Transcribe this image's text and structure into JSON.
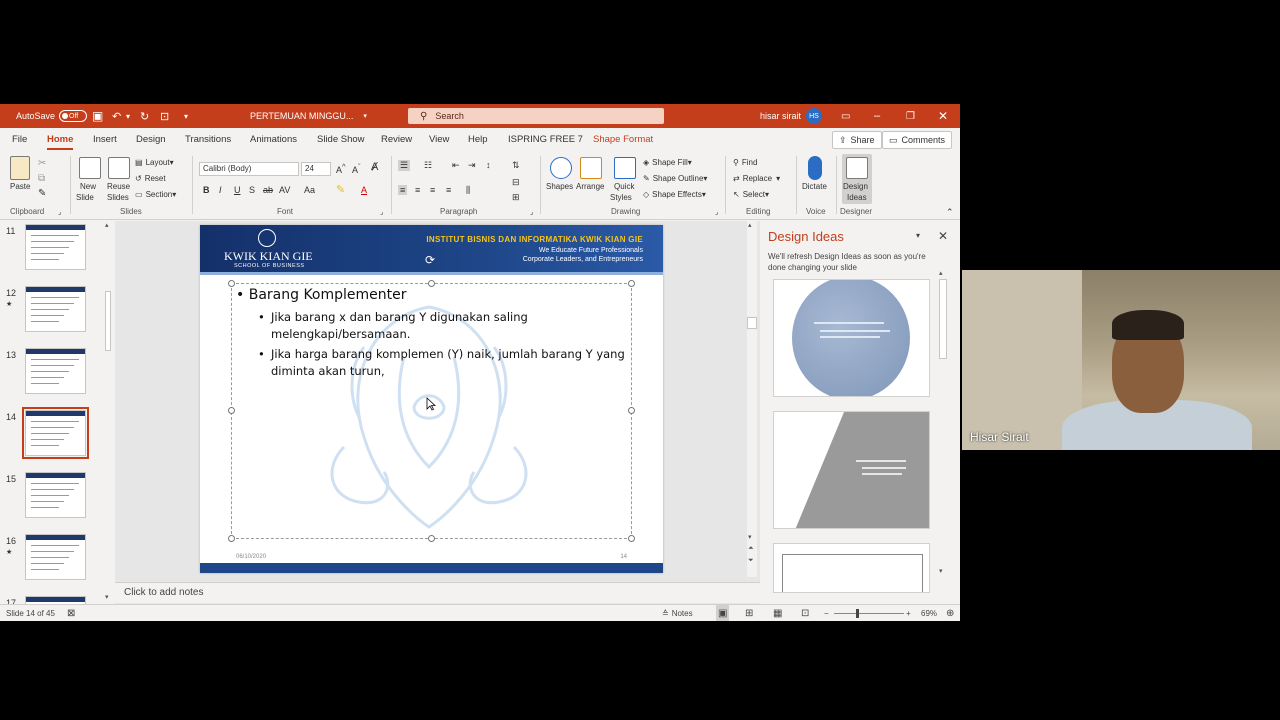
{
  "titlebar": {
    "autosave_label": "AutoSave",
    "autosave_state": "Off",
    "document_title": "PERTEMUAN MINGGU...",
    "search_placeholder": "Search",
    "user_name": "hisar sirait",
    "user_initials": "HS"
  },
  "tabs": [
    "File",
    "Home",
    "Insert",
    "Design",
    "Transitions",
    "Animations",
    "Slide Show",
    "Review",
    "View",
    "Help",
    "ISPRING FREE 7",
    "Shape Format"
  ],
  "active_tab": "Home",
  "share_label": "Share",
  "comments_label": "Comments",
  "ribbon": {
    "clipboard": {
      "paste": "Paste",
      "label": "Clipboard"
    },
    "slides": {
      "new_slide": "New",
      "new_slide2": "Slide",
      "reuse": "Reuse",
      "reuse2": "Slides",
      "layout": "Layout",
      "reset": "Reset",
      "section": "Section",
      "label": "Slides"
    },
    "font": {
      "family": "Calibri (Body)",
      "size": "24",
      "label": "Font"
    },
    "paragraph": {
      "label": "Paragraph"
    },
    "drawing": {
      "shapes": "Shapes",
      "arrange": "Arrange",
      "quick": "Quick",
      "styles": "Styles",
      "fill": "Shape Fill",
      "outline": "Shape Outline",
      "effects": "Shape Effects",
      "label": "Drawing"
    },
    "editing": {
      "find": "Find",
      "replace": "Replace",
      "select": "Select",
      "label": "Editing"
    },
    "voice": {
      "dictate": "Dictate",
      "label": "Voice"
    },
    "designer": {
      "design": "Design",
      "ideas": "Ideas",
      "label": "Designer"
    }
  },
  "thumbnails": [
    {
      "num": "11",
      "star": ""
    },
    {
      "num": "12",
      "star": "★"
    },
    {
      "num": "13",
      "star": ""
    },
    {
      "num": "14",
      "star": ""
    },
    {
      "num": "15",
      "star": ""
    },
    {
      "num": "16",
      "star": "★"
    },
    {
      "num": "17",
      "star": ""
    }
  ],
  "selected_slide": 14,
  "slide": {
    "institute": "INSTITUT BISNIS DAN INFORMATIKA KWIK KIAN GIE",
    "tagline1": "We Educate Future Professionals",
    "tagline2": "Corporate Leaders, and Entrepreneurs",
    "logo_text": "KWIK KIAN GIE",
    "logo_sub": "SCHOOL OF BUSINESS",
    "heading": "Barang Komplementer",
    "bullets": [
      "Jika barang x dan barang Y digunakan saling melengkapi/bersamaan.",
      "Jika harga barang komplemen (Y) naik, jumlah barang Y yang diminta akan turun,"
    ],
    "date": "06/10/2020",
    "number": "14"
  },
  "notes_placeholder": "Click to add notes",
  "design_ideas": {
    "title": "Design Ideas",
    "subtitle": "We'll refresh Design Ideas as soon as you're done changing your slide"
  },
  "status": {
    "slide_info": "Slide 14 of 45",
    "notes": "Notes",
    "zoom": "69%"
  },
  "video": {
    "participant_name": "Hisar Sirait"
  },
  "colors": {
    "accent": "#c43e1c",
    "slide_header": "#1e4688",
    "institute_text": "#f5c518"
  }
}
